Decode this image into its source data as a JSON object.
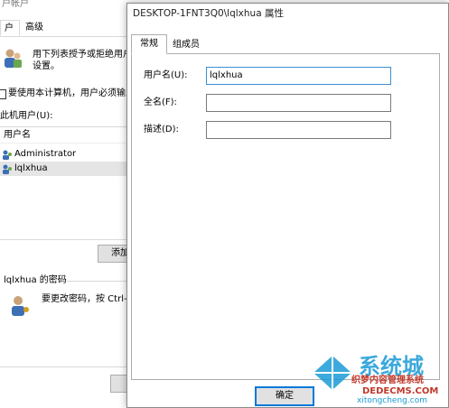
{
  "background_window": {
    "title_fragment": "户帐户",
    "tabs": [
      {
        "label": "户"
      },
      {
        "label": "高级"
      }
    ],
    "intro_line1": "用下列表授予或拒绝用户",
    "intro_line2": "设置。",
    "checkbox_label": "要使用本计算机，用户必须输入",
    "users_label": "此机用户(U):",
    "list_header": "用户名",
    "users": [
      {
        "name": "Administrator"
      },
      {
        "name": "lqlxhua"
      }
    ],
    "add_button": "添加",
    "password_group": "lqlxhua 的密码",
    "password_text": "要更改密码，按 Ctrl-Alt-"
  },
  "dialog": {
    "title": "DESKTOP-1FNT3Q0\\lqlxhua 属性",
    "tabs": [
      {
        "label": "常规"
      },
      {
        "label": "组成员"
      }
    ],
    "fields": [
      {
        "label": "用户名(U):",
        "value": "lqlxhua"
      },
      {
        "label": "全名(F):",
        "value": ""
      },
      {
        "label": "描述(D):",
        "value": ""
      }
    ],
    "ok_button": "确定"
  },
  "watermark": {
    "brand": "系统城",
    "line1": "织梦内容管理系统",
    "domain1": "DEDECMS.COM",
    "domain2": "xitongcheng.com"
  },
  "colors": {
    "accent": "#0078d7",
    "selection": "#e5e5e5",
    "watermark_blue": "#1a9bd6"
  }
}
